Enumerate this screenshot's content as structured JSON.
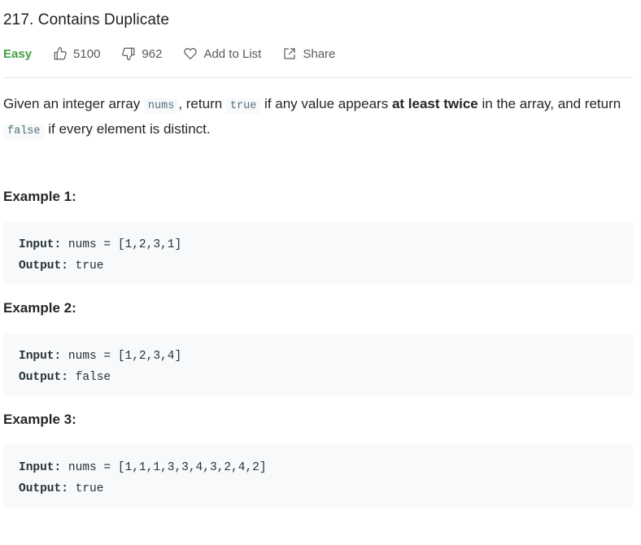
{
  "problem": {
    "title": "217. Contains Duplicate",
    "difficulty": "Easy",
    "likes": "5100",
    "dislikes": "962",
    "add_to_list_label": "Add to List",
    "share_label": "Share"
  },
  "colors": {
    "difficulty_easy": "#43a047",
    "code_bg": "#f7f9fa",
    "divider": "#e6e6e6"
  },
  "icons": {
    "like": "thumbs-up-icon",
    "dislike": "thumbs-down-icon",
    "add_to_list": "heart-icon",
    "share": "share-icon"
  },
  "description": {
    "p1": "Given an integer array ",
    "code1": "nums",
    "p2": ", return ",
    "code2": "true",
    "p3": " if any value appears ",
    "bold": "at least twice",
    "p4": " in the array, and return ",
    "code3": "false",
    "p5": " if every element is distinct."
  },
  "examples": [
    {
      "title": "Example 1:",
      "input_label": "Input:",
      "input_value": " nums = [1,2,3,1]",
      "output_label": "Output:",
      "output_value": " true"
    },
    {
      "title": "Example 2:",
      "input_label": "Input:",
      "input_value": " nums = [1,2,3,4]",
      "output_label": "Output:",
      "output_value": " false"
    },
    {
      "title": "Example 3:",
      "input_label": "Input:",
      "input_value": " nums = [1,1,1,3,3,4,3,2,4,2]",
      "output_label": "Output:",
      "output_value": " true"
    }
  ]
}
